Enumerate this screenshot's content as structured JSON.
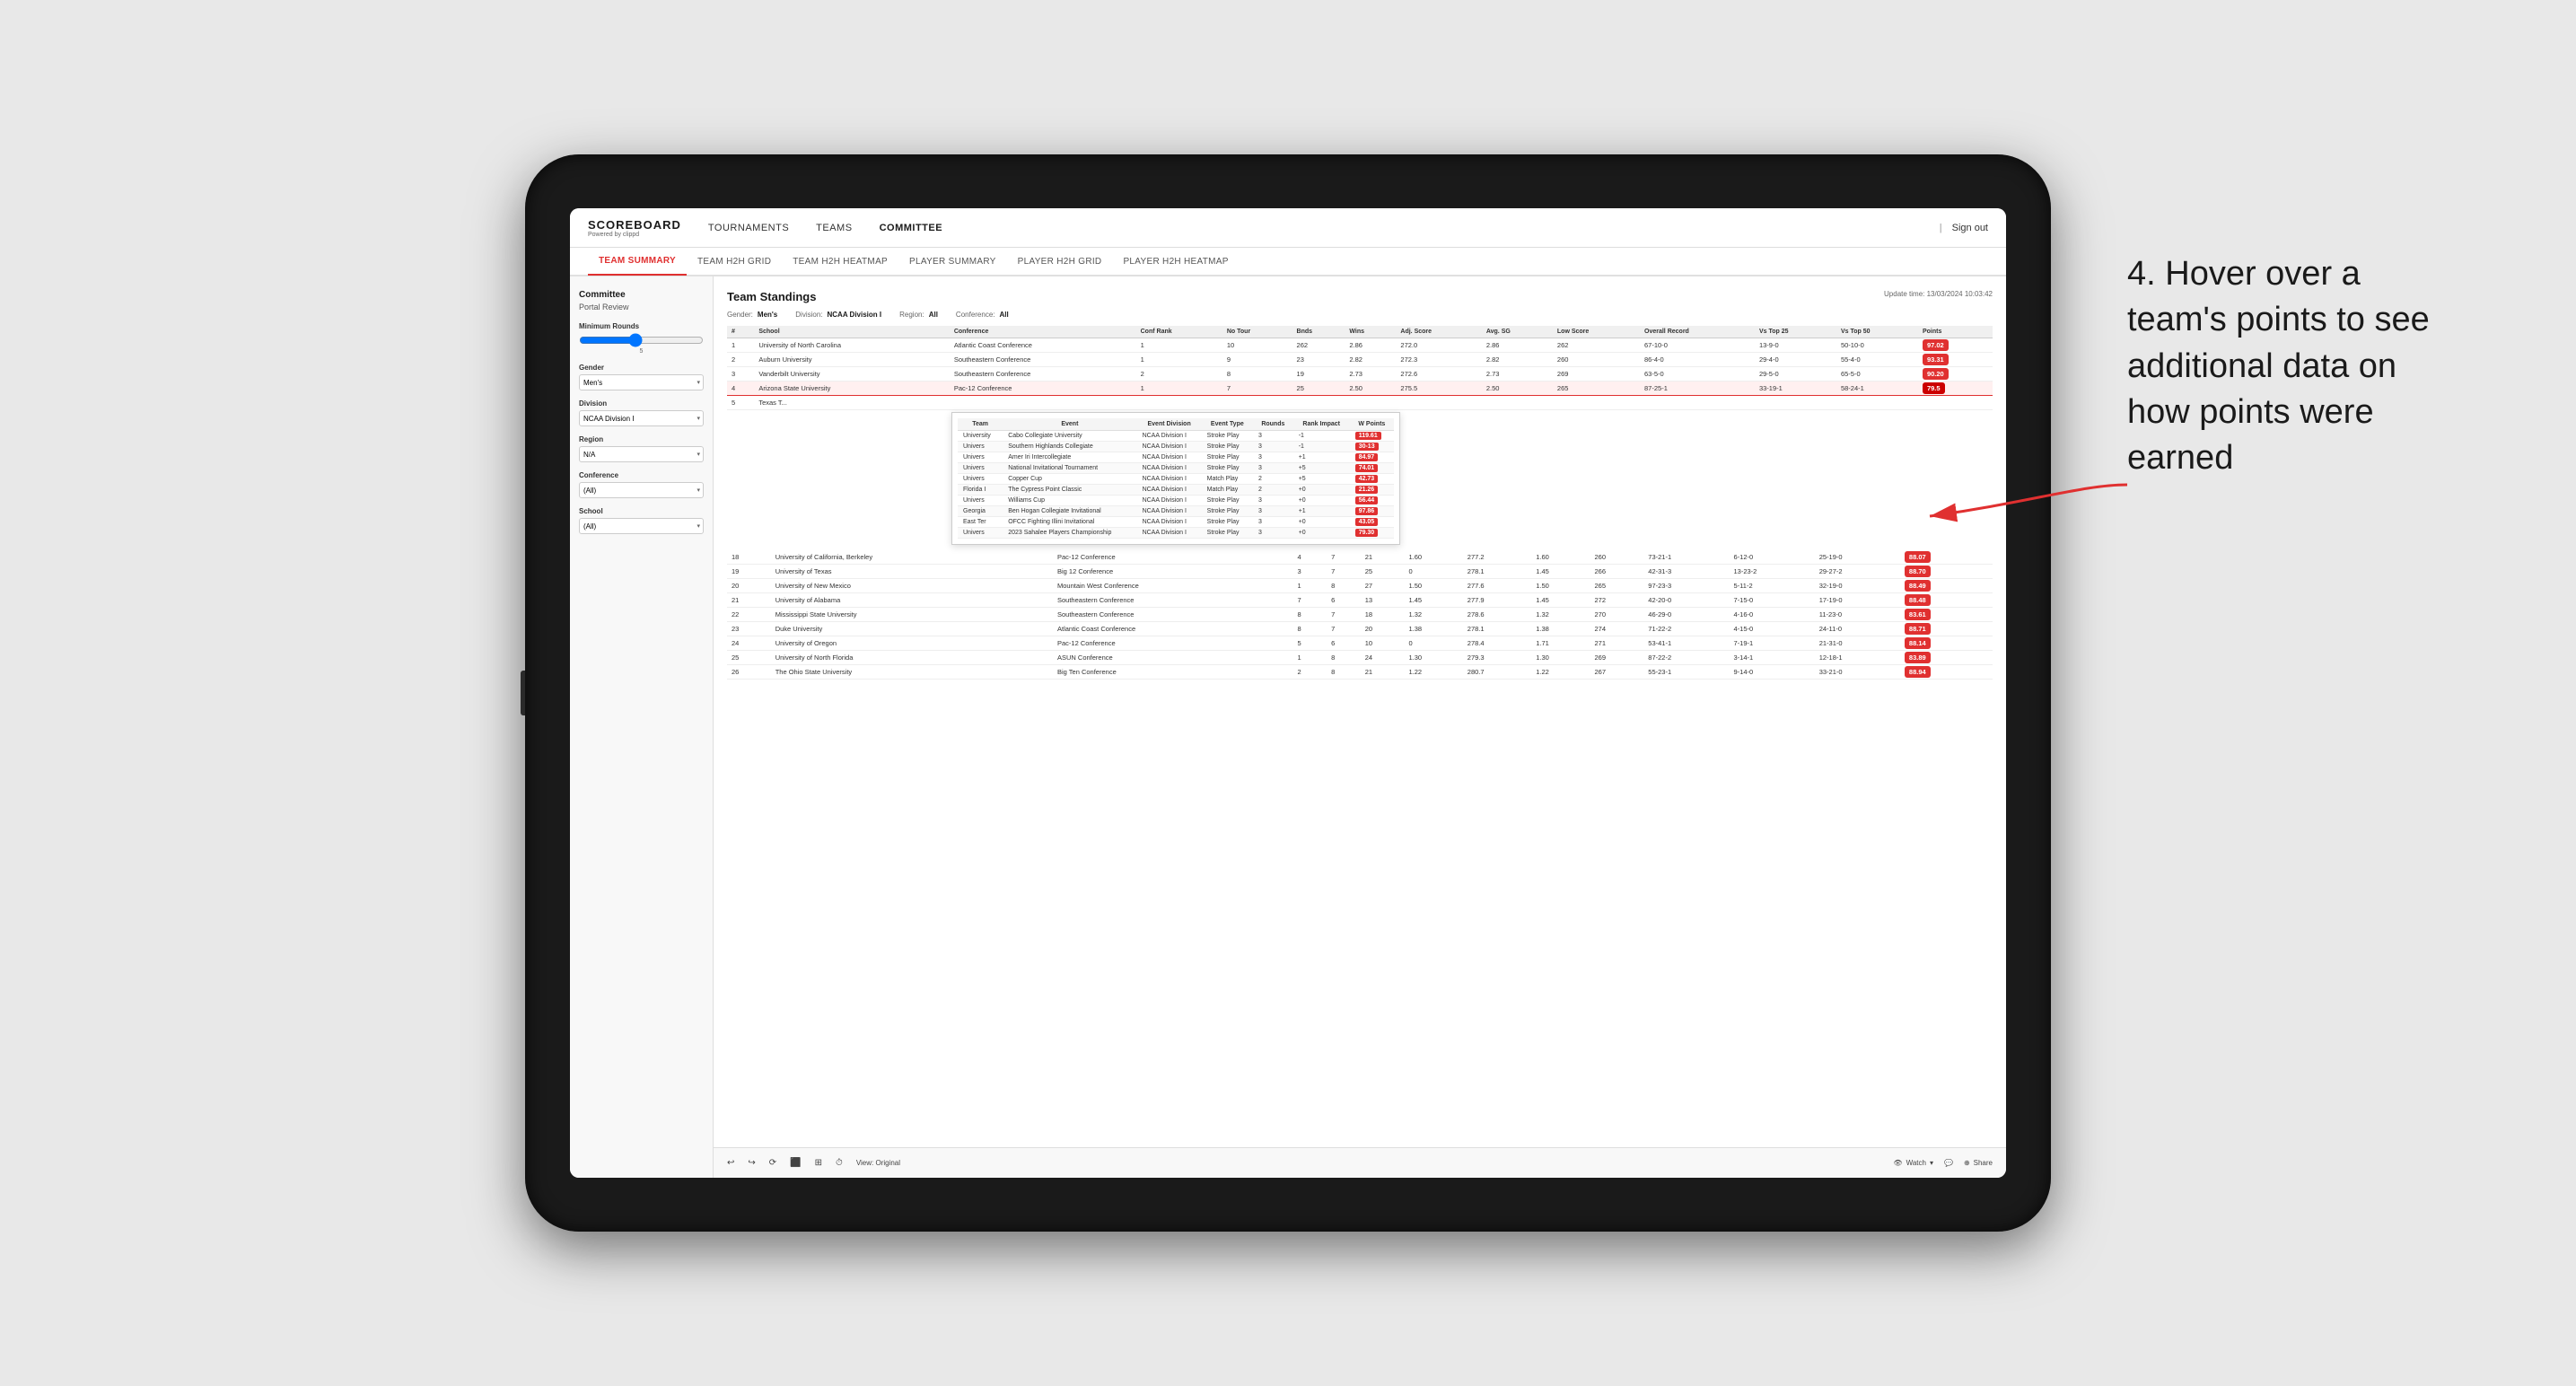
{
  "app": {
    "title": "SCOREBOARD",
    "subtitle": "Powered by clippd",
    "sign_out": "Sign out"
  },
  "nav": {
    "items": [
      {
        "label": "TOURNAMENTS",
        "active": false
      },
      {
        "label": "TEAMS",
        "active": false
      },
      {
        "label": "COMMITTEE",
        "active": true
      }
    ]
  },
  "sub_nav": {
    "items": [
      {
        "label": "TEAM SUMMARY",
        "active": true
      },
      {
        "label": "TEAM H2H GRID",
        "active": false
      },
      {
        "label": "TEAM H2H HEATMAP",
        "active": false
      },
      {
        "label": "PLAYER SUMMARY",
        "active": false
      },
      {
        "label": "PLAYER H2H GRID",
        "active": false
      },
      {
        "label": "PLAYER H2H HEATMAP",
        "active": false
      }
    ]
  },
  "sidebar": {
    "title": "Committee",
    "subtitle": "Portal Review",
    "sections": [
      {
        "label": "Minimum Rounds",
        "type": "slider",
        "value": "5"
      },
      {
        "label": "Gender",
        "type": "select",
        "value": "Men's"
      },
      {
        "label": "Division",
        "type": "select",
        "value": "NCAA Division I"
      },
      {
        "label": "Region",
        "type": "select",
        "value": "N/A"
      },
      {
        "label": "Conference",
        "type": "select",
        "value": "(All)"
      },
      {
        "label": "School",
        "type": "select",
        "value": "(All)"
      }
    ]
  },
  "standings": {
    "title": "Team Standings",
    "update_time": "Update time: 13/03/2024 10:03:42",
    "filters": {
      "gender": "Men's",
      "division": "NCAA Division I",
      "region": "All",
      "conference": "All"
    },
    "columns": [
      "#",
      "School",
      "Conference",
      "Conf Rank",
      "No Tour",
      "Bnds",
      "Wins",
      "Adj. Score",
      "Avg. SG",
      "Low Score",
      "Overall Record",
      "Vs Top 25",
      "Vs Top 50",
      "Points"
    ],
    "rows": [
      {
        "rank": 1,
        "school": "University of North Carolina",
        "conference": "Atlantic Coast Conference",
        "conf_rank": 1,
        "no_tour": 10,
        "bnds": 262,
        "wins": "2.86",
        "adj_score": 272.0,
        "avg_sg": "2.86",
        "low_score": 262,
        "overall": "67-10-0",
        "vs25": "13-9-0",
        "vs50": "50-10-0",
        "points": "97.02",
        "highlight": false
      },
      {
        "rank": 2,
        "school": "Auburn University",
        "conference": "Southeastern Conference",
        "conf_rank": 1,
        "no_tour": 9,
        "bnds": 23,
        "wins": "2.82",
        "adj_score": 272.3,
        "avg_sg": "2.82",
        "low_score": 260,
        "overall": "86-4-0",
        "vs25": "29-4-0",
        "vs50": "55-4-0",
        "points": "93.31",
        "highlight": false
      },
      {
        "rank": 3,
        "school": "Vanderbilt University",
        "conference": "Southeastern Conference",
        "conf_rank": 2,
        "no_tour": 8,
        "bnds": 19,
        "wins": "2.73",
        "adj_score": 272.6,
        "avg_sg": "2.73",
        "low_score": 269,
        "overall": "63-5-0",
        "vs25": "29-5-0",
        "vs50": "65-5-0",
        "points": "90.20",
        "highlight": false
      },
      {
        "rank": 4,
        "school": "Arizona State University",
        "conference": "Pac-12 Conference",
        "conf_rank": 1,
        "no_tour": 7,
        "bnds": 25,
        "wins": "2.50",
        "adj_score": 275.5,
        "avg_sg": "2.50",
        "low_score": 265,
        "overall": "87-25-1",
        "vs25": "33-19-1",
        "vs50": "58-24-1",
        "points": "79.5",
        "highlight": true
      },
      {
        "rank": 5,
        "school": "Texas T...",
        "conference": "",
        "conf_rank": "",
        "no_tour": "",
        "bnds": "",
        "wins": "",
        "adj_score": "",
        "avg_sg": "",
        "low_score": "",
        "overall": "",
        "vs25": "",
        "vs50": "",
        "points": "",
        "highlight": false
      }
    ],
    "tooltip_rows": [
      {
        "team": "University",
        "event": "Cabo Collegiate",
        "event_division": "NCAA Division I",
        "event_type": "Stroke Play",
        "rounds": 3,
        "rank_impact": -1,
        "points": "119.61"
      },
      {
        "team": "University",
        "event": "Southern Highlands Collegiate",
        "event_division": "NCAA Division I",
        "event_type": "Stroke Play",
        "rounds": 3,
        "rank_impact": -1,
        "points": "30-13"
      },
      {
        "team": "Univers",
        "event": "Amer Iri Intercollegiate",
        "event_division": "NCAA Division I",
        "event_type": "Stroke Play",
        "rounds": 3,
        "rank_impact": "+1",
        "points": "84.97"
      },
      {
        "team": "Univers",
        "event": "National Invitational Tournament",
        "event_division": "NCAA Division I",
        "event_type": "Stroke Play",
        "rounds": 3,
        "rank_impact": "+5",
        "points": "74.01"
      },
      {
        "team": "Univers",
        "event": "Copper Cup",
        "event_division": "NCAA Division I",
        "event_type": "Match Play",
        "rounds": 2,
        "rank_impact": "+5",
        "points": "42.73"
      },
      {
        "team": "Florida I",
        "event": "The Cypress Point Classic",
        "event_division": "NCAA Division I",
        "event_type": "Match Play",
        "rounds": 2,
        "rank_impact": "+0",
        "points": "21.26"
      },
      {
        "team": "Univers",
        "event": "Williams Cup",
        "event_division": "NCAA Division I",
        "event_type": "Stroke Play",
        "rounds": 3,
        "rank_impact": "+0",
        "points": "56.44"
      },
      {
        "team": "Georgia",
        "event": "Ben Hogan Collegiate Invitational",
        "event_division": "NCAA Division I",
        "event_type": "Stroke Play",
        "rounds": 3,
        "rank_impact": "+1",
        "points": "97.86"
      },
      {
        "team": "East Ter",
        "event": "OFCC Fighting Illini Invitational",
        "event_division": "NCAA Division I",
        "event_type": "Stroke Play",
        "rounds": 3,
        "rank_impact": "+0",
        "points": "43.05"
      },
      {
        "team": "Univers",
        "event": "2023 Sahalee Players Championship",
        "event_division": "NCAA Division I",
        "event_type": "Stroke Play",
        "rounds": 3,
        "rank_impact": "+0",
        "points": "79.30"
      }
    ],
    "more_rows": [
      {
        "rank": 18,
        "school": "University of California, Berkeley",
        "conference": "Pac-12 Conference",
        "conf_rank": 4,
        "no_tour": 7,
        "bnds": 21,
        "wins": "1.60",
        "adj_score": 277.2,
        "avg_sg": "1.60",
        "low_score": 260,
        "overall": "73-21-1",
        "vs25": "6-12-0",
        "vs50": "25-19-0",
        "points": "88.07"
      },
      {
        "rank": 19,
        "school": "University of Texas",
        "conference": "Big 12 Conference",
        "conf_rank": 3,
        "no_tour": 7,
        "bnds": 25,
        "wins": "0",
        "adj_score": 278.1,
        "avg_sg": "1.45",
        "low_score": 266,
        "overall": "42-31-3",
        "vs25": "13-23-2",
        "vs50": "29-27-2",
        "points": "88.70"
      },
      {
        "rank": 20,
        "school": "University of New Mexico",
        "conference": "Mountain West Conference",
        "conf_rank": 1,
        "no_tour": 8,
        "bnds": 27,
        "wins": "1.50",
        "adj_score": 277.6,
        "avg_sg": "1.50",
        "low_score": 265,
        "overall": "97-23-3",
        "vs25": "5-11-2",
        "vs50": "32-19-0",
        "points": "88.49"
      },
      {
        "rank": 21,
        "school": "University of Alabama",
        "conference": "Southeastern Conference",
        "conf_rank": 7,
        "no_tour": 6,
        "bnds": 13,
        "wins": "1.45",
        "adj_score": 277.9,
        "avg_sg": "1.45",
        "low_score": 272,
        "overall": "42-20-0",
        "vs25": "7-15-0",
        "vs50": "17-19-0",
        "points": "88.48"
      },
      {
        "rank": 22,
        "school": "Mississippi State University",
        "conference": "Southeastern Conference",
        "conf_rank": 8,
        "no_tour": 7,
        "bnds": 18,
        "wins": "1.32",
        "adj_score": 278.6,
        "avg_sg": "1.32",
        "low_score": 270,
        "overall": "46-29-0",
        "vs25": "4-16-0",
        "vs50": "11-23-0",
        "points": "83.61"
      },
      {
        "rank": 23,
        "school": "Duke University",
        "conference": "Atlantic Coast Conference",
        "conf_rank": 8,
        "no_tour": 7,
        "bnds": 20,
        "wins": "1.38",
        "adj_score": 278.1,
        "avg_sg": "1.38",
        "low_score": 274,
        "overall": "71-22-2",
        "vs25": "4-15-0",
        "vs50": "24-11-0",
        "points": "88.71"
      },
      {
        "rank": 24,
        "school": "University of Oregon",
        "conference": "Pac-12 Conference",
        "conf_rank": 5,
        "no_tour": 6,
        "bnds": 10,
        "wins": "0",
        "adj_score": 278.4,
        "avg_sg": "1.71",
        "low_score": 271,
        "overall": "53-41-1",
        "vs25": "7-19-1",
        "vs50": "21-31-0",
        "points": "88.14"
      },
      {
        "rank": 25,
        "school": "University of North Florida",
        "conference": "ASUN Conference",
        "conf_rank": 1,
        "no_tour": 8,
        "bnds": 24,
        "wins": "1.30",
        "adj_score": 279.3,
        "avg_sg": "1.30",
        "low_score": 269,
        "overall": "87-22-2",
        "vs25": "3-14-1",
        "vs50": "12-18-1",
        "points": "83.89"
      },
      {
        "rank": 26,
        "school": "The Ohio State University",
        "conference": "Big Ten Conference",
        "conf_rank": 2,
        "no_tour": 8,
        "bnds": 21,
        "wins": "1.22",
        "adj_score": 280.7,
        "avg_sg": "1.22",
        "low_score": 267,
        "overall": "55-23-1",
        "vs25": "9-14-0",
        "vs50": "33-21-0",
        "points": "88.94"
      }
    ]
  },
  "toolbar": {
    "undo": "↩",
    "redo": "↪",
    "save": "💾",
    "view_original": "View: Original",
    "watch": "Watch",
    "comment": "💬",
    "share": "Share"
  },
  "annotation": {
    "text": "4. Hover over a team's points to see additional data on how points were earned"
  }
}
